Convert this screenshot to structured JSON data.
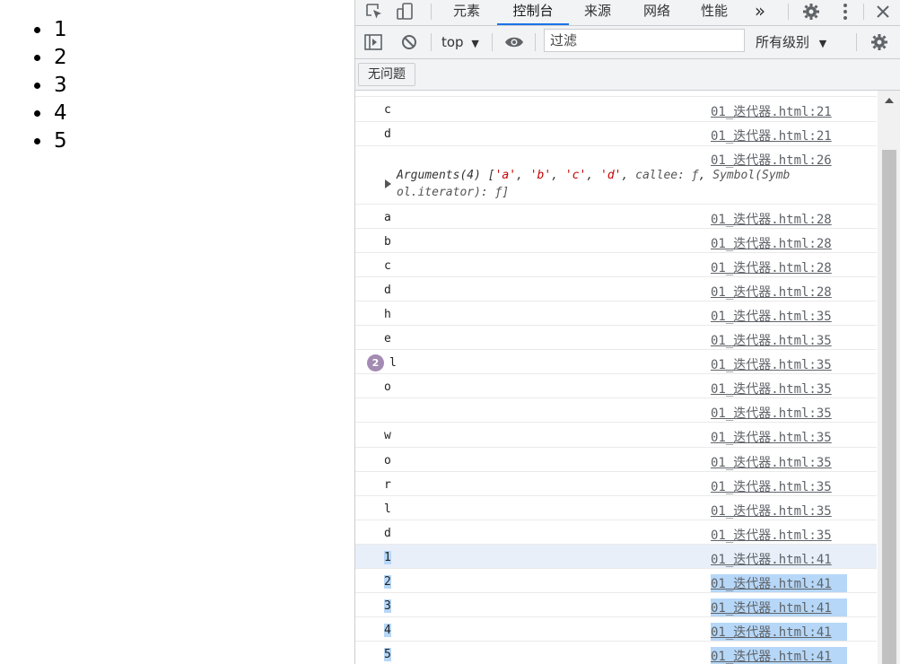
{
  "page": {
    "list_items": [
      "1",
      "2",
      "3",
      "4",
      "5"
    ]
  },
  "devtools": {
    "tabs": [
      {
        "label": "元素",
        "active": false
      },
      {
        "label": "控制台",
        "active": true
      },
      {
        "label": "来源",
        "active": false
      },
      {
        "label": "网络",
        "active": false
      },
      {
        "label": "性能",
        "active": false
      }
    ],
    "more_tabs_glyph": "»",
    "toolbar": {
      "context": "top",
      "filter_placeholder": "过滤",
      "levels": "所有级别"
    },
    "issues_button": "无问题",
    "console": {
      "rows": [
        {
          "msg": "c",
          "src": "01_迭代器.html:21"
        },
        {
          "msg": "d",
          "src": "01_迭代器.html:21"
        },
        {
          "msg": "",
          "src": "01_迭代器.html:26"
        },
        {
          "msg": "a",
          "src": "01_迭代器.html:28"
        },
        {
          "msg": "b",
          "src": "01_迭代器.html:28"
        },
        {
          "msg": "c",
          "src": "01_迭代器.html:28"
        },
        {
          "msg": "d",
          "src": "01_迭代器.html:28"
        },
        {
          "msg": "h",
          "src": "01_迭代器.html:35"
        },
        {
          "msg": "e",
          "src": "01_迭代器.html:35"
        },
        {
          "msg": "l",
          "src": "01_迭代器.html:35",
          "count": "2"
        },
        {
          "msg": "o",
          "src": "01_迭代器.html:35"
        },
        {
          "msg": "",
          "src": "01_迭代器.html:35"
        },
        {
          "msg": "w",
          "src": "01_迭代器.html:35"
        },
        {
          "msg": "o",
          "src": "01_迭代器.html:35"
        },
        {
          "msg": "r",
          "src": "01_迭代器.html:35"
        },
        {
          "msg": "l",
          "src": "01_迭代器.html:35"
        },
        {
          "msg": "d",
          "src": "01_迭代器.html:35"
        },
        {
          "msg": "1",
          "src": "01_迭代器.html:41"
        },
        {
          "msg": "2",
          "src": "01_迭代器.html:41"
        },
        {
          "msg": "3",
          "src": "01_迭代器.html:41"
        },
        {
          "msg": "4",
          "src": "01_迭代器.html:41"
        },
        {
          "msg": "5",
          "src": "01_迭代器.html:41"
        }
      ],
      "arguments": {
        "prefix": "Arguments(4) [",
        "items": [
          "'a'",
          "'b'",
          "'c'",
          "'d'"
        ],
        "callee": "callee: ƒ",
        "line1_tail": "Symbol(Symb",
        "line2": "ol.iterator): ƒ]"
      }
    },
    "colors": {
      "accent": "#1a73e8",
      "selection": "#b6d7f7",
      "badge": "#a38bb3"
    }
  }
}
